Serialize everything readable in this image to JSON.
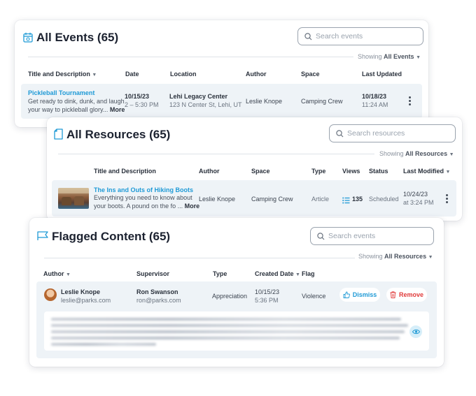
{
  "events": {
    "title": "All Events (65)",
    "search_placeholder": "Search events",
    "showing_prefix": "Showing",
    "showing_value": "All Events",
    "columns": {
      "title_desc": "Title and Description",
      "date": "Date",
      "location": "Location",
      "author": "Author",
      "space": "Space",
      "last_updated": "Last Updated"
    },
    "row": {
      "title": "Pickleball Tournament",
      "desc_line1": "Get ready to dink, dunk, and laugh",
      "desc_line2": "your way to pickleball glory...",
      "more": "More",
      "date": "10/15/23",
      "time": "2 – 5:30 PM",
      "location_name": "Lehi Legacy Center",
      "location_addr": "123 N Center St, Lehi, UT",
      "author": "Leslie Knope",
      "space": "Camping Crew",
      "updated_date": "10/18/23",
      "updated_time": "11:24 AM"
    }
  },
  "resources": {
    "title": "All Resources (65)",
    "search_placeholder": "Search resources",
    "showing_prefix": "Showing",
    "showing_value": "All Resources",
    "columns": {
      "title_desc": "Title and Description",
      "author": "Author",
      "space": "Space",
      "type": "Type",
      "views": "Views",
      "status": "Status",
      "last_modified": "Last Modified"
    },
    "row": {
      "title": "The Ins and Outs of Hiking Boots",
      "desc_line1": "Everything you need to know about",
      "desc_line2": "your boots. A pound on the fo ...",
      "more": "More",
      "author": "Leslie Knope",
      "space": "Camping Crew",
      "type": "Article",
      "views": "135",
      "status": "Scheduled",
      "modified_date": "10/24/23",
      "modified_time": "at 3:24 PM"
    }
  },
  "flagged": {
    "title": "Flagged Content (65)",
    "search_placeholder": "Search events",
    "showing_prefix": "Showing",
    "showing_value": "All Resources",
    "columns": {
      "author": "Author",
      "supervisor": "Supervisor",
      "type": "Type",
      "created_date": "Created Date",
      "flag": "Flag"
    },
    "row": {
      "author_name": "Leslie Knope",
      "author_email": "leslie@parks.com",
      "supervisor_name": "Ron Swanson",
      "supervisor_email": "ron@parks.com",
      "type": "Appreciation",
      "created_date": "10/15/23",
      "created_time": "5:36 PM",
      "flag": "Violence",
      "dismiss": "Dismiss",
      "remove": "Remove"
    }
  },
  "colors": {
    "accent": "#1f9ad6",
    "danger": "#e03a3a"
  },
  "icons": {
    "events": "calendar-icon",
    "resources": "document-icon",
    "flagged": "flag-icon",
    "search": "search-icon",
    "views": "list-icon",
    "dismiss": "thumbs-up-icon",
    "remove": "trash-icon",
    "preview": "eye-icon"
  }
}
